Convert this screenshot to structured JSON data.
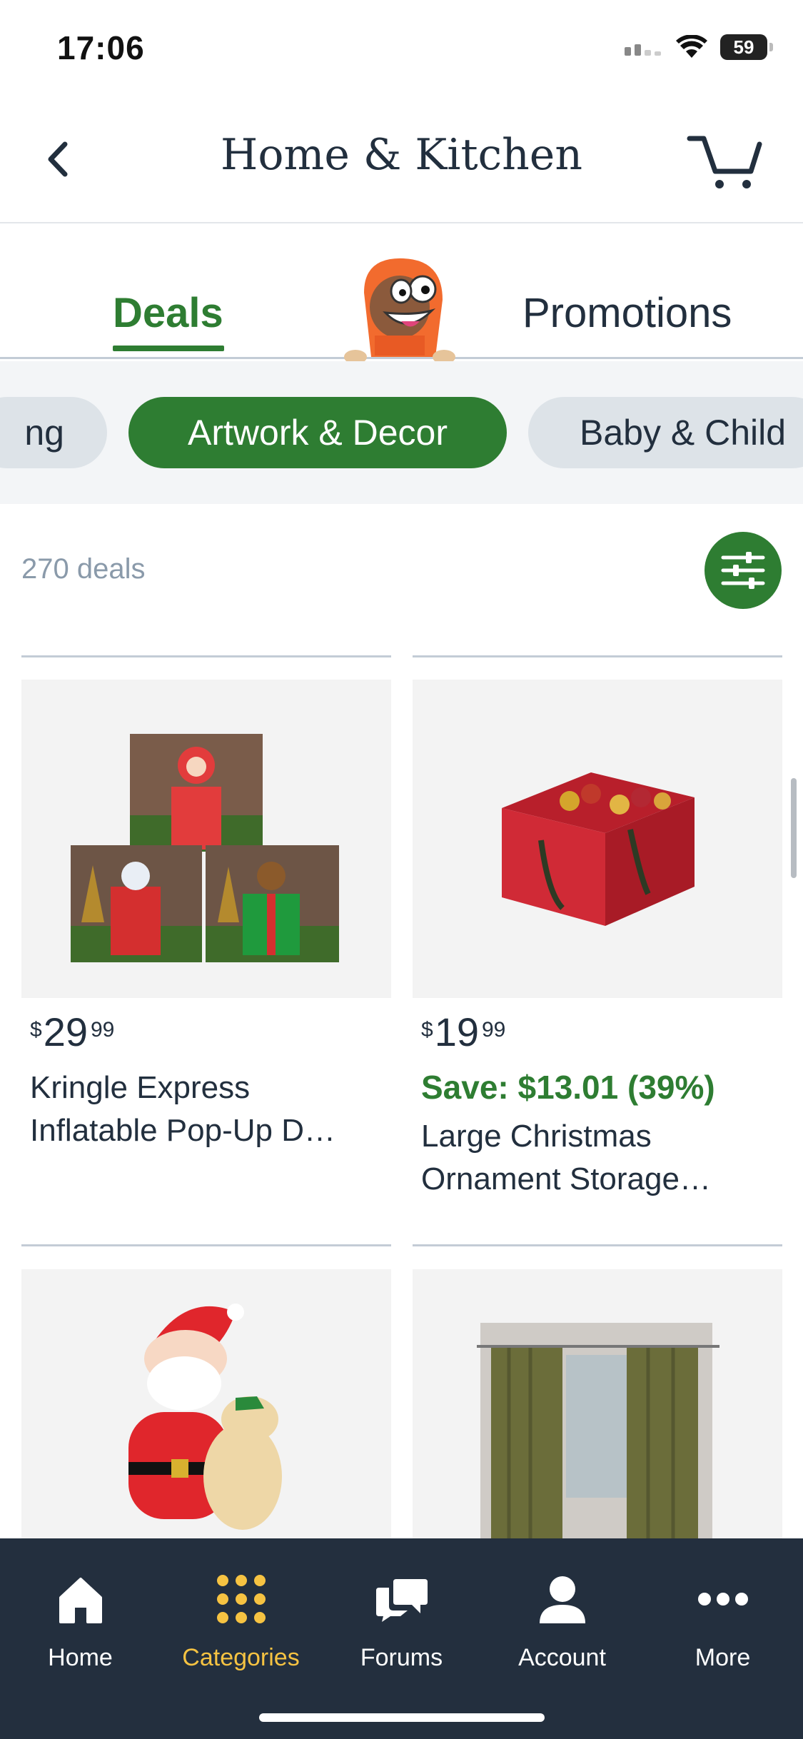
{
  "status_bar": {
    "time": "17:06",
    "battery": "59"
  },
  "header": {
    "title": "Home & Kitchen"
  },
  "tabs": [
    {
      "label": "Deals",
      "active": true
    },
    {
      "label": "Promotions",
      "active": false
    }
  ],
  "chips": [
    {
      "label": "ng",
      "active": false
    },
    {
      "label": "Artwork & Decor",
      "active": true
    },
    {
      "label": "Baby & Child",
      "active": false
    }
  ],
  "deals_count": "270 deals",
  "products": [
    {
      "price_symbol": "$",
      "price_whole": "29",
      "price_fraction": "99",
      "save": "",
      "title": "Kringle Express Inflatable Pop-Up D…"
    },
    {
      "price_symbol": "$",
      "price_whole": "19",
      "price_fraction": "99",
      "save": "Save: $13.01 (39%)",
      "title": "Large Christmas Ornament Storage…"
    }
  ],
  "bottom_nav": [
    {
      "label": "Home",
      "icon": "home-icon"
    },
    {
      "label": "Categories",
      "icon": "grid-icon",
      "active": true
    },
    {
      "label": "Forums",
      "icon": "chat-icon"
    },
    {
      "label": "Account",
      "icon": "person-icon"
    },
    {
      "label": "More",
      "icon": "more-icon"
    }
  ],
  "colors": {
    "accent_green": "#2e7d32",
    "nav_bg": "#232f3e",
    "active_nav": "#f6c342",
    "text_dark": "#222f3e"
  }
}
